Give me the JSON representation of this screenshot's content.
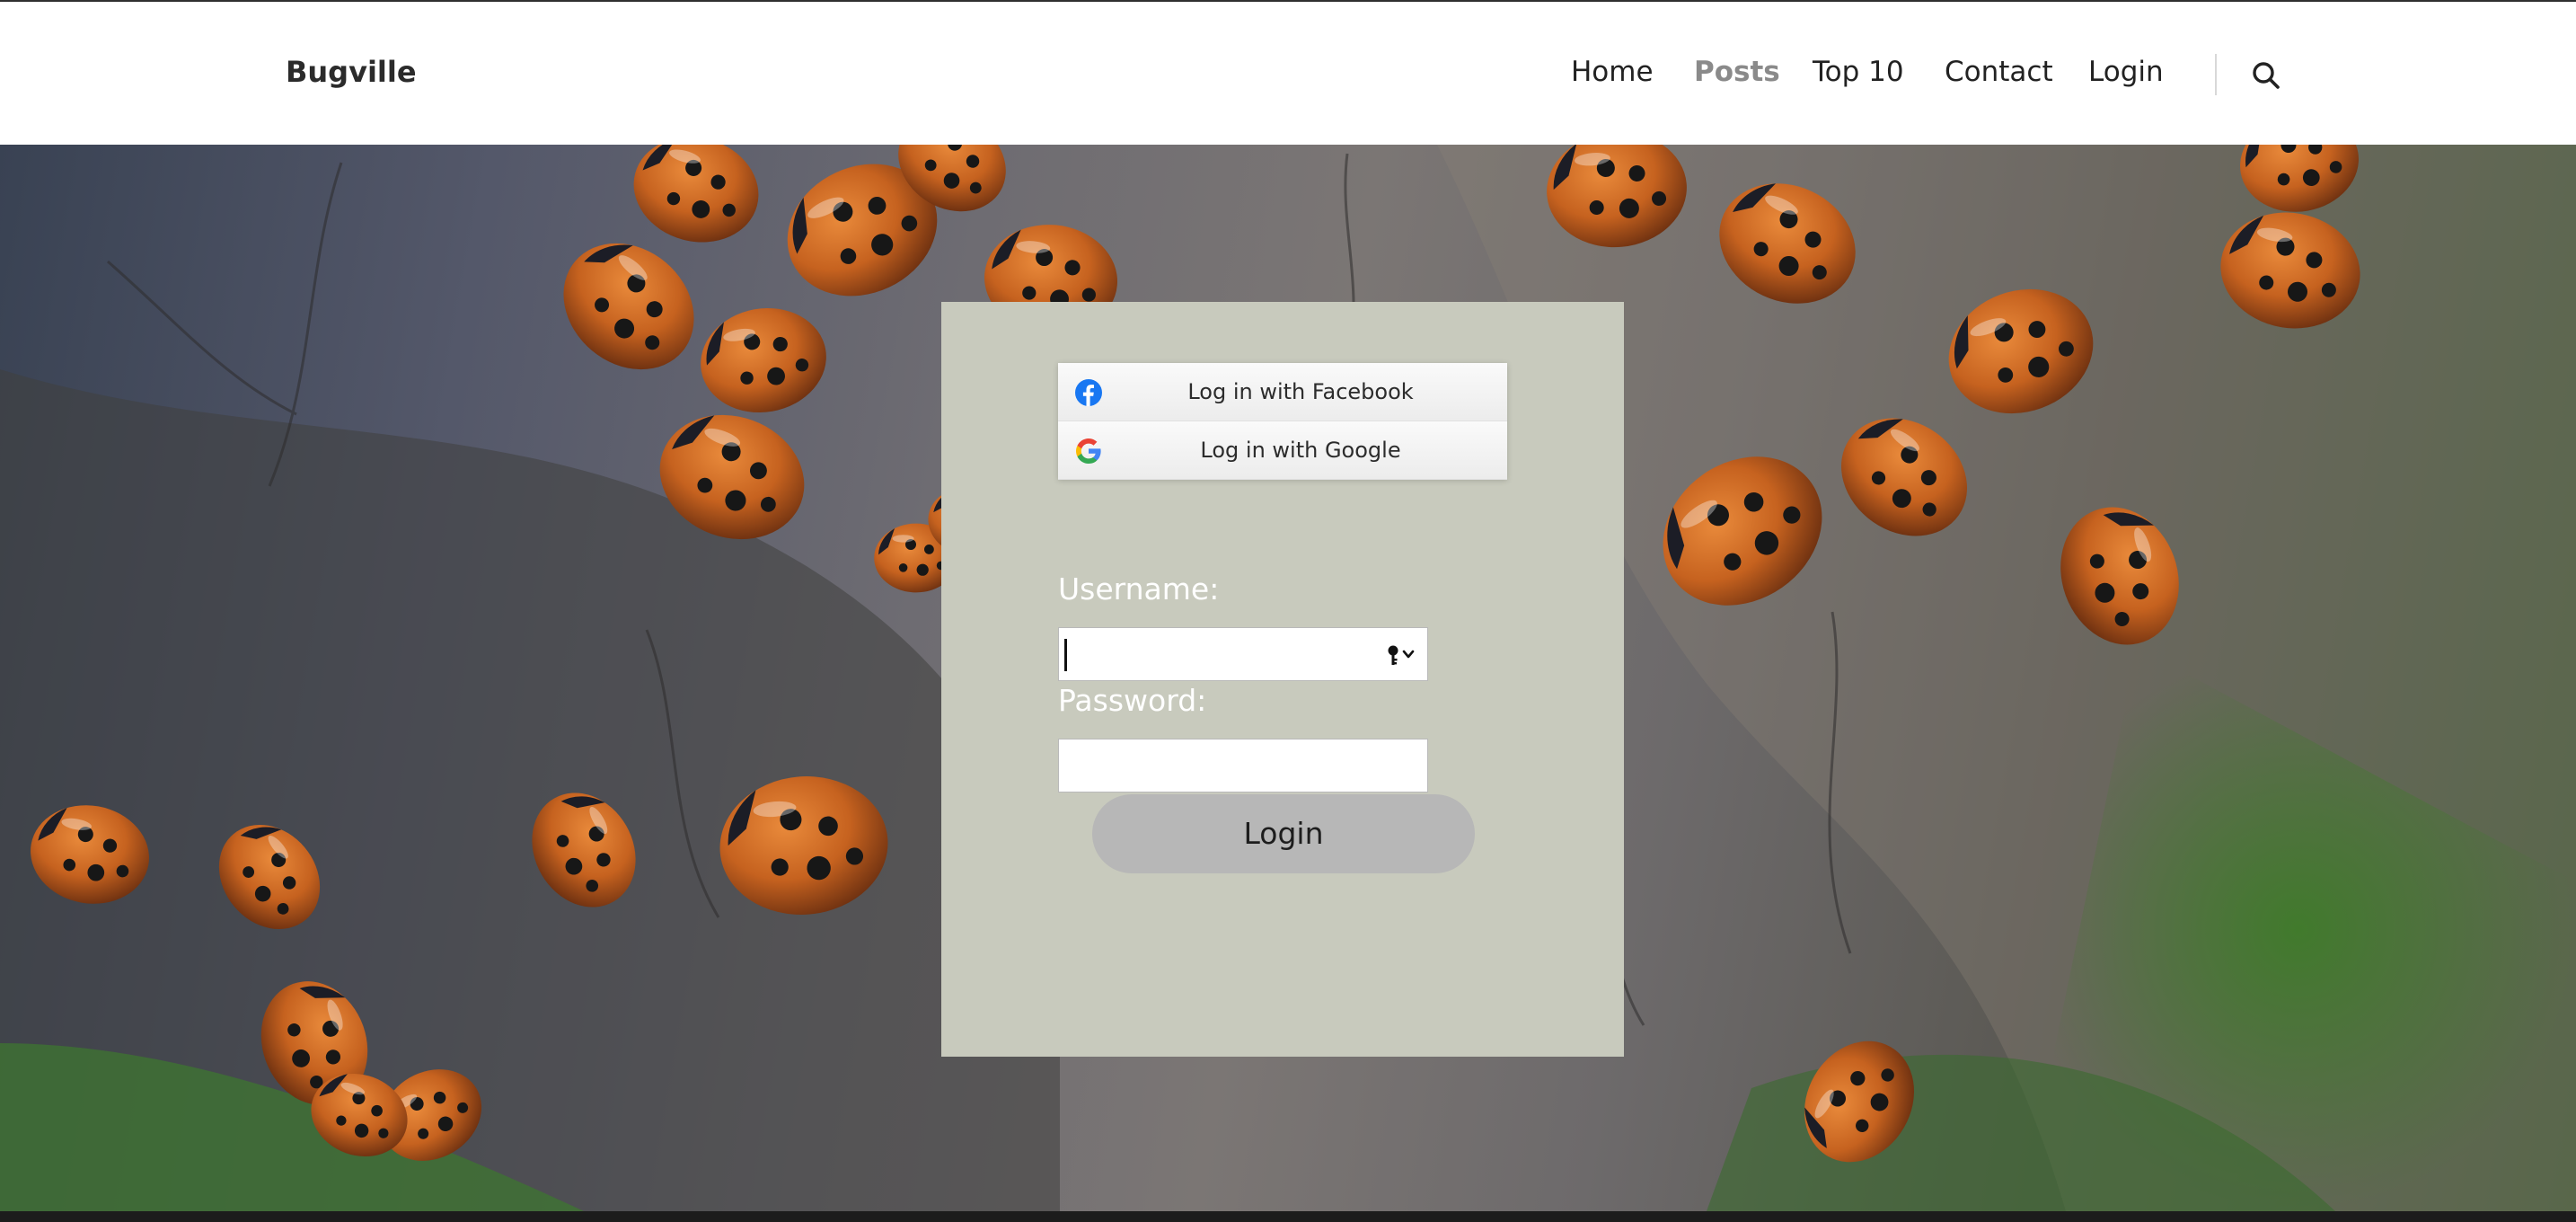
{
  "header": {
    "brand": "Bugville",
    "nav": [
      {
        "label": "Home",
        "active": false
      },
      {
        "label": "Posts",
        "active": true
      },
      {
        "label": "Top 10",
        "active": false
      },
      {
        "label": "Contact",
        "active": false
      },
      {
        "label": "Login",
        "active": false
      }
    ],
    "search_icon": "search-icon"
  },
  "login": {
    "facebook_label": "Log in with Facebook",
    "google_label": "Log in with Google",
    "username_label": "Username:",
    "username_value": "",
    "password_label": "Password:",
    "password_value": "",
    "submit_label": "Login"
  },
  "colors": {
    "card_background": "#c8cabd",
    "button_background": "#b7b7b7",
    "active_nav": "#8a8a8a",
    "facebook_blue": "#1877f2"
  }
}
